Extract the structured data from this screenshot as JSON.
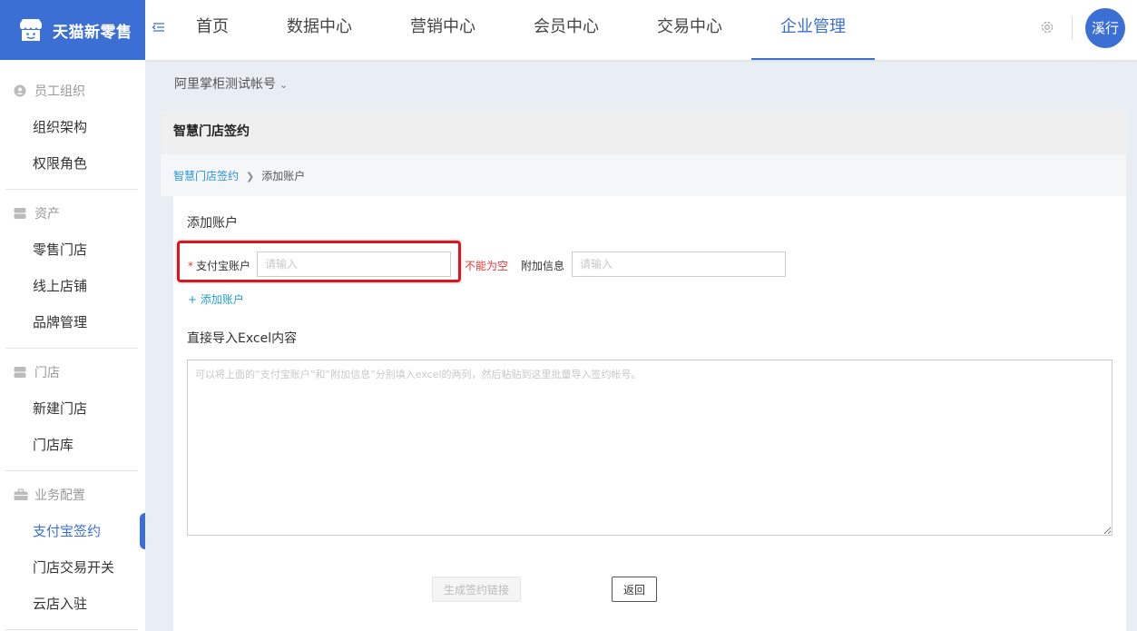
{
  "app": {
    "logo_text": "天猫新零售",
    "logo_icon": "store-icon",
    "brand_color": "#3c6fd3"
  },
  "nav": {
    "items": [
      {
        "label": "首页"
      },
      {
        "label": "数据中心"
      },
      {
        "label": "营销中心"
      },
      {
        "label": "会员中心"
      },
      {
        "label": "交易中心"
      },
      {
        "label": "企业管理",
        "active": true
      }
    ]
  },
  "user": {
    "avatar_text": "溪行"
  },
  "sidebar": {
    "groups": [
      {
        "title": "员工组织",
        "icon": "team-icon",
        "items": [
          "组织架构",
          "权限角色"
        ]
      },
      {
        "title": "资产",
        "icon": "database-icon",
        "items": [
          "零售门店",
          "线上店铺",
          "品牌管理"
        ]
      },
      {
        "title": "门店",
        "icon": "database-icon",
        "items": [
          "新建门店",
          "门店库"
        ]
      },
      {
        "title": "业务配置",
        "icon": "briefcase-icon",
        "items": [
          "支付宝签约",
          "门店交易开关",
          "云店入驻"
        ]
      }
    ],
    "active_item": "支付宝签约"
  },
  "account": {
    "label": "阿里掌柜测试帐号"
  },
  "panel": {
    "title": "智慧门店签约"
  },
  "breadcrumb": {
    "link": "智慧门店签约",
    "current": "添加账户"
  },
  "form": {
    "section_title": "添加账户",
    "alipay_label": "支付宝账户",
    "required_mark": "*",
    "alipay_placeholder": "请输入",
    "alipay_error": "不能为空",
    "extra_label": "附加信息",
    "extra_placeholder": "请输入",
    "add_account": "+ 添加账户",
    "import_title": "直接导入Excel内容",
    "import_placeholder": "可以将上面的“支付宝账户”和“附加信息”分别填入excel的两列，然后粘贴到这里批量导入签约帐号。",
    "generate_button": "生成签约链接",
    "back_button": "返回"
  }
}
